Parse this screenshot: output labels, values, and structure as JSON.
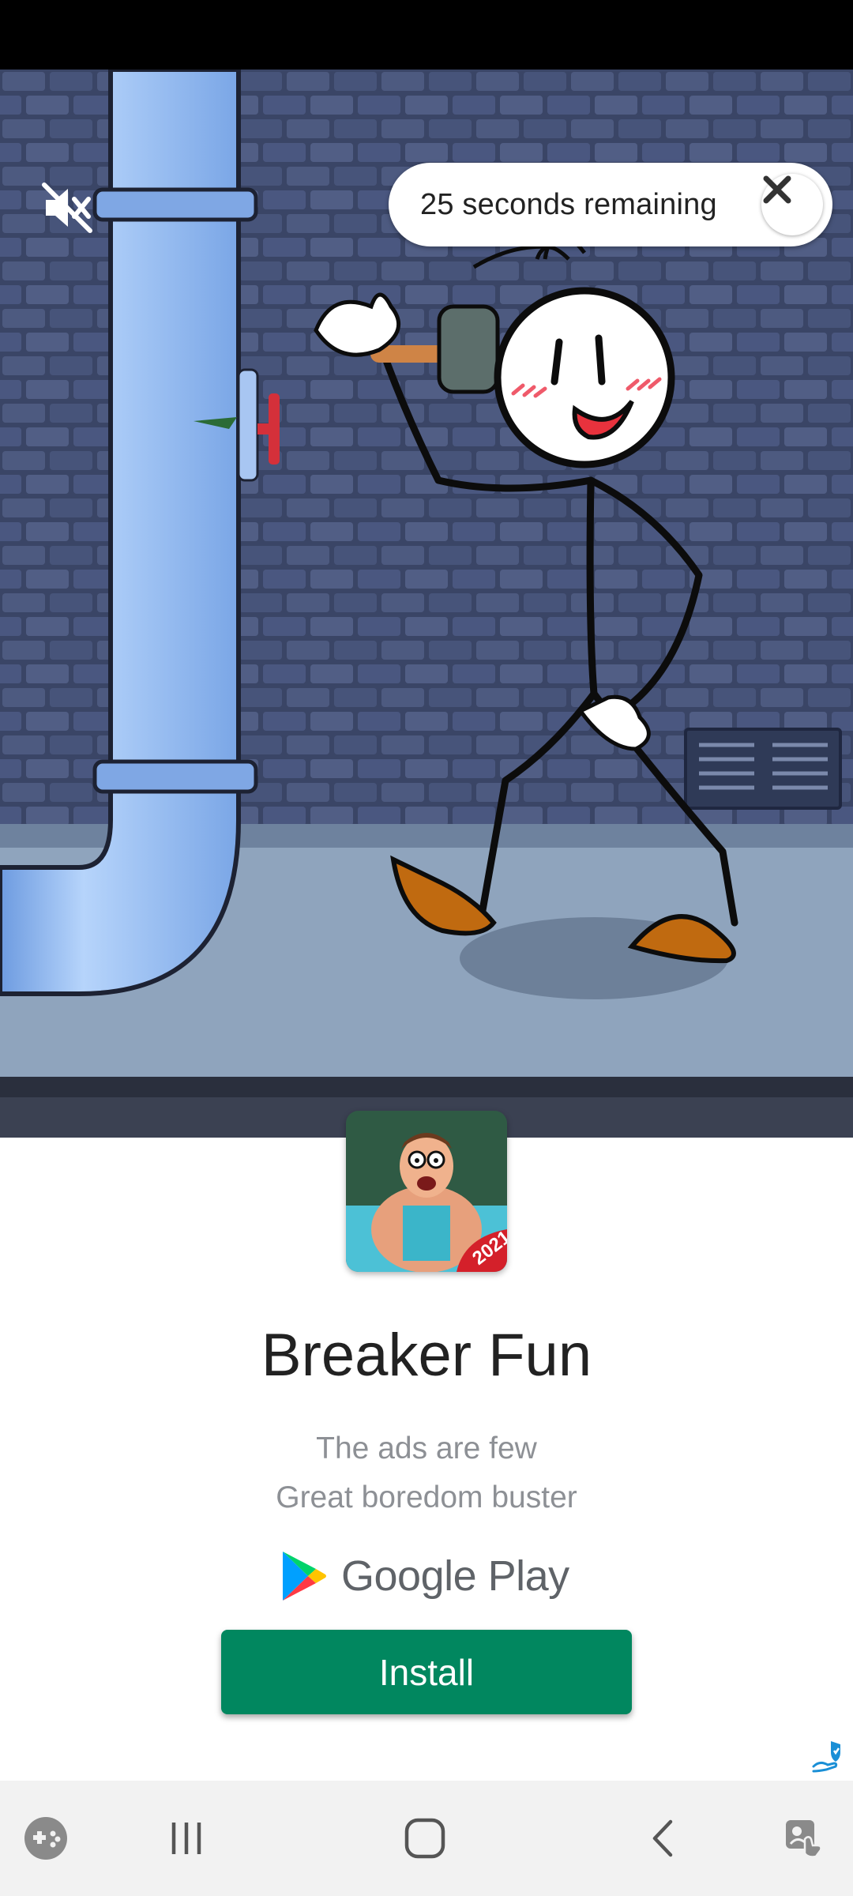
{
  "ad": {
    "timer_text": "25 seconds remaining",
    "close_icon": "close-icon",
    "mute_icon": "volume-muted-icon",
    "ad_choices_icon": "ad-choices-icon"
  },
  "app": {
    "name": "Breaker Fun",
    "icon_badge": "2021",
    "taglines": [
      "The ads are few",
      "Great boredom buster"
    ],
    "store_name": "Google Play",
    "install_label": "Install",
    "install_color": "#01875f"
  },
  "nav": {
    "items": [
      "game-launcher-icon",
      "recent-apps-icon",
      "home-icon",
      "back-icon",
      "accessibility-icon"
    ]
  }
}
